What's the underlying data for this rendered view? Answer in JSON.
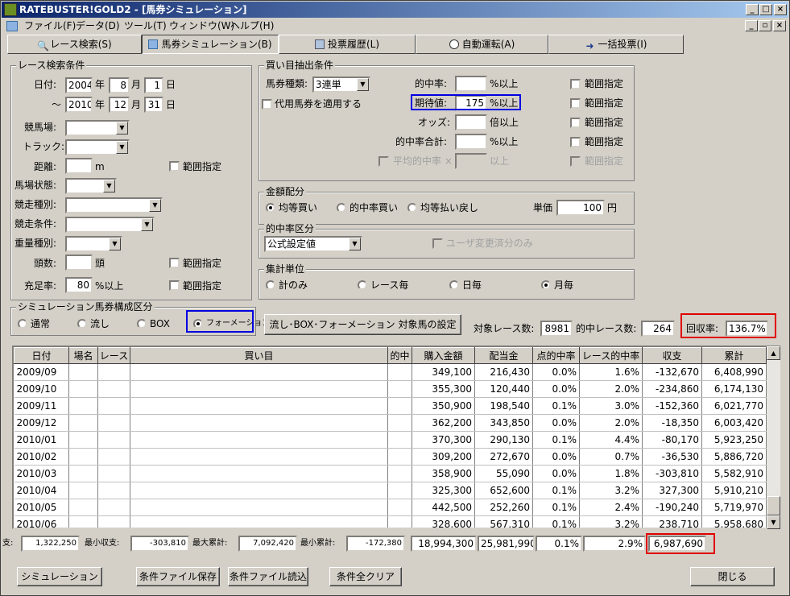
{
  "window": {
    "title": "RATEBUSTER!GOLD2 - [馬券シミュレーション]"
  },
  "menu": [
    "ファイル(F)",
    "データ(D)",
    "ツール(T)",
    "ウィンドウ(W)",
    "ヘルプ(H)"
  ],
  "tabs": [
    {
      "label": "レース検索(S)",
      "icon": "search-icon"
    },
    {
      "label": "馬券シミュレーション(B)",
      "icon": "grid-icon"
    },
    {
      "label": "投票履歴(L)",
      "icon": "document-icon"
    },
    {
      "label": "自動運転(A)",
      "icon": "clock-icon"
    },
    {
      "label": "一括投票(I)",
      "icon": "arrow-icon"
    }
  ],
  "race_search": {
    "title": "レース検索条件",
    "date_label": "日付:",
    "year_unit": "年",
    "month_unit": "月",
    "day_unit": "日",
    "tilde": "～",
    "from_year": "2004",
    "from_month": "8",
    "from_day": "1",
    "to_year": "2010",
    "to_month": "12",
    "to_day": "31",
    "venue_label": "競馬場:",
    "track_label": "トラック:",
    "distance_label": "距離:",
    "distance_unit": "m",
    "range_label": "範囲指定",
    "condition_label": "馬場状態:",
    "race_type_label": "競走種別:",
    "race_cond_label": "競走条件:",
    "weight_label": "重量種別:",
    "heads_label": "頭数:",
    "heads_unit": "頭",
    "fill_label": "充足率:",
    "fill_value": "80",
    "fill_unit": "%以上"
  },
  "bet_extract": {
    "title": "買い目抽出条件",
    "type_label": "馬券種類:",
    "type_value": "3連単",
    "substitute_label": "代用馬券を適用する",
    "hit_label": "的中率:",
    "hit_unit": "%以上",
    "expect_label": "期待値:",
    "expect_value": "175",
    "expect_unit": "%以上",
    "odds_label": "オッズ:",
    "odds_unit": "倍以上",
    "hit_total_label": "的中率合計:",
    "hit_total_unit": "%以上",
    "avg_label": "平均的中率 ×",
    "avg_unit": "以上",
    "range_label": "範囲指定"
  },
  "allocation": {
    "title": "金額配分",
    "options": [
      "均等買い",
      "的中率買い",
      "均等払い戻し"
    ],
    "unit_label": "単価",
    "unit_value": "100",
    "yen": "円"
  },
  "hit_class": {
    "title": "的中率区分",
    "value": "公式設定値",
    "user_only": "ユーザ変更済分のみ"
  },
  "agg_unit": {
    "title": "集計単位",
    "options": [
      "計のみ",
      "レース毎",
      "日毎",
      "月毎"
    ]
  },
  "sim_type": {
    "title": "シミュレーション馬券構成区分",
    "options": [
      "通常",
      "流し",
      "BOX",
      "フォーメーション"
    ]
  },
  "settings_button": "流し･BOX･フォーメーション 対象馬の設定",
  "stats": {
    "target_label": "対象レース数:",
    "target_value": "8981",
    "hit_label": "的中レース数:",
    "hit_value": "264",
    "return_label": "回収率:",
    "return_value": "136.7%"
  },
  "table": {
    "headers": [
      "日付",
      "場名",
      "レース",
      "買い目",
      "的中",
      "購入金額",
      "配当金",
      "点的中率",
      "レース的中率",
      "収支",
      "累計"
    ],
    "rows": [
      [
        "2009/09",
        "",
        "",
        "",
        "",
        "349,100",
        "216,430",
        "0.0%",
        "1.6%",
        "-132,670",
        "6,408,990"
      ],
      [
        "2009/10",
        "",
        "",
        "",
        "",
        "355,300",
        "120,440",
        "0.0%",
        "2.0%",
        "-234,860",
        "6,174,130"
      ],
      [
        "2009/11",
        "",
        "",
        "",
        "",
        "350,900",
        "198,540",
        "0.1%",
        "3.0%",
        "-152,360",
        "6,021,770"
      ],
      [
        "2009/12",
        "",
        "",
        "",
        "",
        "362,200",
        "343,850",
        "0.0%",
        "2.0%",
        "-18,350",
        "6,003,420"
      ],
      [
        "2010/01",
        "",
        "",
        "",
        "",
        "370,300",
        "290,130",
        "0.1%",
        "4.4%",
        "-80,170",
        "5,923,250"
      ],
      [
        "2010/02",
        "",
        "",
        "",
        "",
        "309,200",
        "272,670",
        "0.0%",
        "0.7%",
        "-36,530",
        "5,886,720"
      ],
      [
        "2010/03",
        "",
        "",
        "",
        "",
        "358,900",
        "55,090",
        "0.0%",
        "1.8%",
        "-303,810",
        "5,582,910"
      ],
      [
        "2010/04",
        "",
        "",
        "",
        "",
        "325,300",
        "652,600",
        "0.1%",
        "3.2%",
        "327,300",
        "5,910,210"
      ],
      [
        "2010/05",
        "",
        "",
        "",
        "",
        "442,500",
        "252,260",
        "0.1%",
        "2.4%",
        "-190,240",
        "5,719,970"
      ],
      [
        "2010/06",
        "",
        "",
        "",
        "",
        "328,600",
        "567,310",
        "0.1%",
        "3.2%",
        "238,710",
        "5,958,680"
      ]
    ]
  },
  "summary": {
    "max_label": "支:",
    "max_value": "1,322,250",
    "min_label": "最小収支:",
    "min_value": "-303,810",
    "maxcum_label": "最大累計:",
    "maxcum_value": "7,092,420",
    "mincum_label": "最小累計:",
    "mincum_value": "-172,380",
    "purchase": "18,994,300",
    "payout": "25,981,990",
    "point_hit": "0.1%",
    "race_hit": "2.9%",
    "balance": "6,987,690"
  },
  "buttons": {
    "simulate": "シミュレーション",
    "save": "条件ファイル保存",
    "load": "条件ファイル読込",
    "clear": "条件全クリア",
    "close": "閉じる"
  }
}
